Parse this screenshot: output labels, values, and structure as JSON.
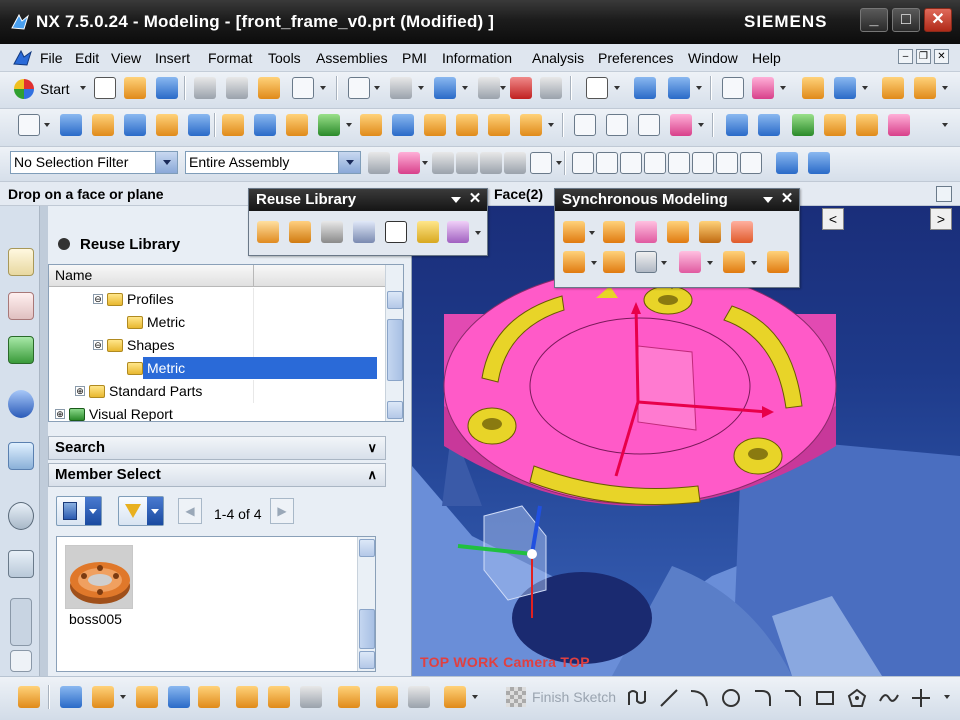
{
  "titlebar": {
    "title": "NX 7.5.0.24 - Modeling - [front_frame_v0.prt (Modified) ]",
    "brand": "SIEMENS",
    "minimize": "_",
    "maximize": "□",
    "close": "✕"
  },
  "menu": {
    "items": [
      "File",
      "Edit",
      "View",
      "Insert",
      "Format",
      "Tools",
      "Assemblies",
      "PMI",
      "Information",
      "Analysis",
      "Preferences",
      "Window",
      "Help"
    ],
    "mdi_minimize": "–",
    "mdi_restore": "❐",
    "mdi_close": "✕"
  },
  "toolbar": {
    "start_label": "Start",
    "selection_filter": "No Selection Filter",
    "scope": "Entire Assembly"
  },
  "cue": {
    "text": "Drop on a face or plane",
    "status_partial": "Face(2)"
  },
  "navigator": {
    "title": "Reuse Library",
    "column_name": "Name",
    "tree": [
      {
        "label": "Profiles",
        "expander": "⊖"
      },
      {
        "label": "Metric"
      },
      {
        "label": "Shapes",
        "expander": "⊖"
      },
      {
        "label": "Metric",
        "selected": true
      },
      {
        "label": "Standard Parts",
        "expander": "⊕"
      },
      {
        "label": "Visual Report",
        "expander": "⊕"
      }
    ],
    "search_header": "Search",
    "search_chevron": "∨",
    "member_header": "Member Select",
    "member_chevron": "∧",
    "page_info": "1-4 of 4",
    "prev": "◀",
    "next": "▶",
    "items": [
      {
        "caption": "boss005"
      }
    ]
  },
  "reuse_toolbar": {
    "title": "Reuse Library",
    "close": "✕"
  },
  "sync_toolbar": {
    "title": "Synchronous Modeling",
    "close": "✕"
  },
  "graphics": {
    "view_label": "TOP WORK Camera TOP",
    "scroll_left": "<",
    "scroll_right": ">"
  },
  "bottom": {
    "finish_sketch": "Finish Sketch"
  }
}
